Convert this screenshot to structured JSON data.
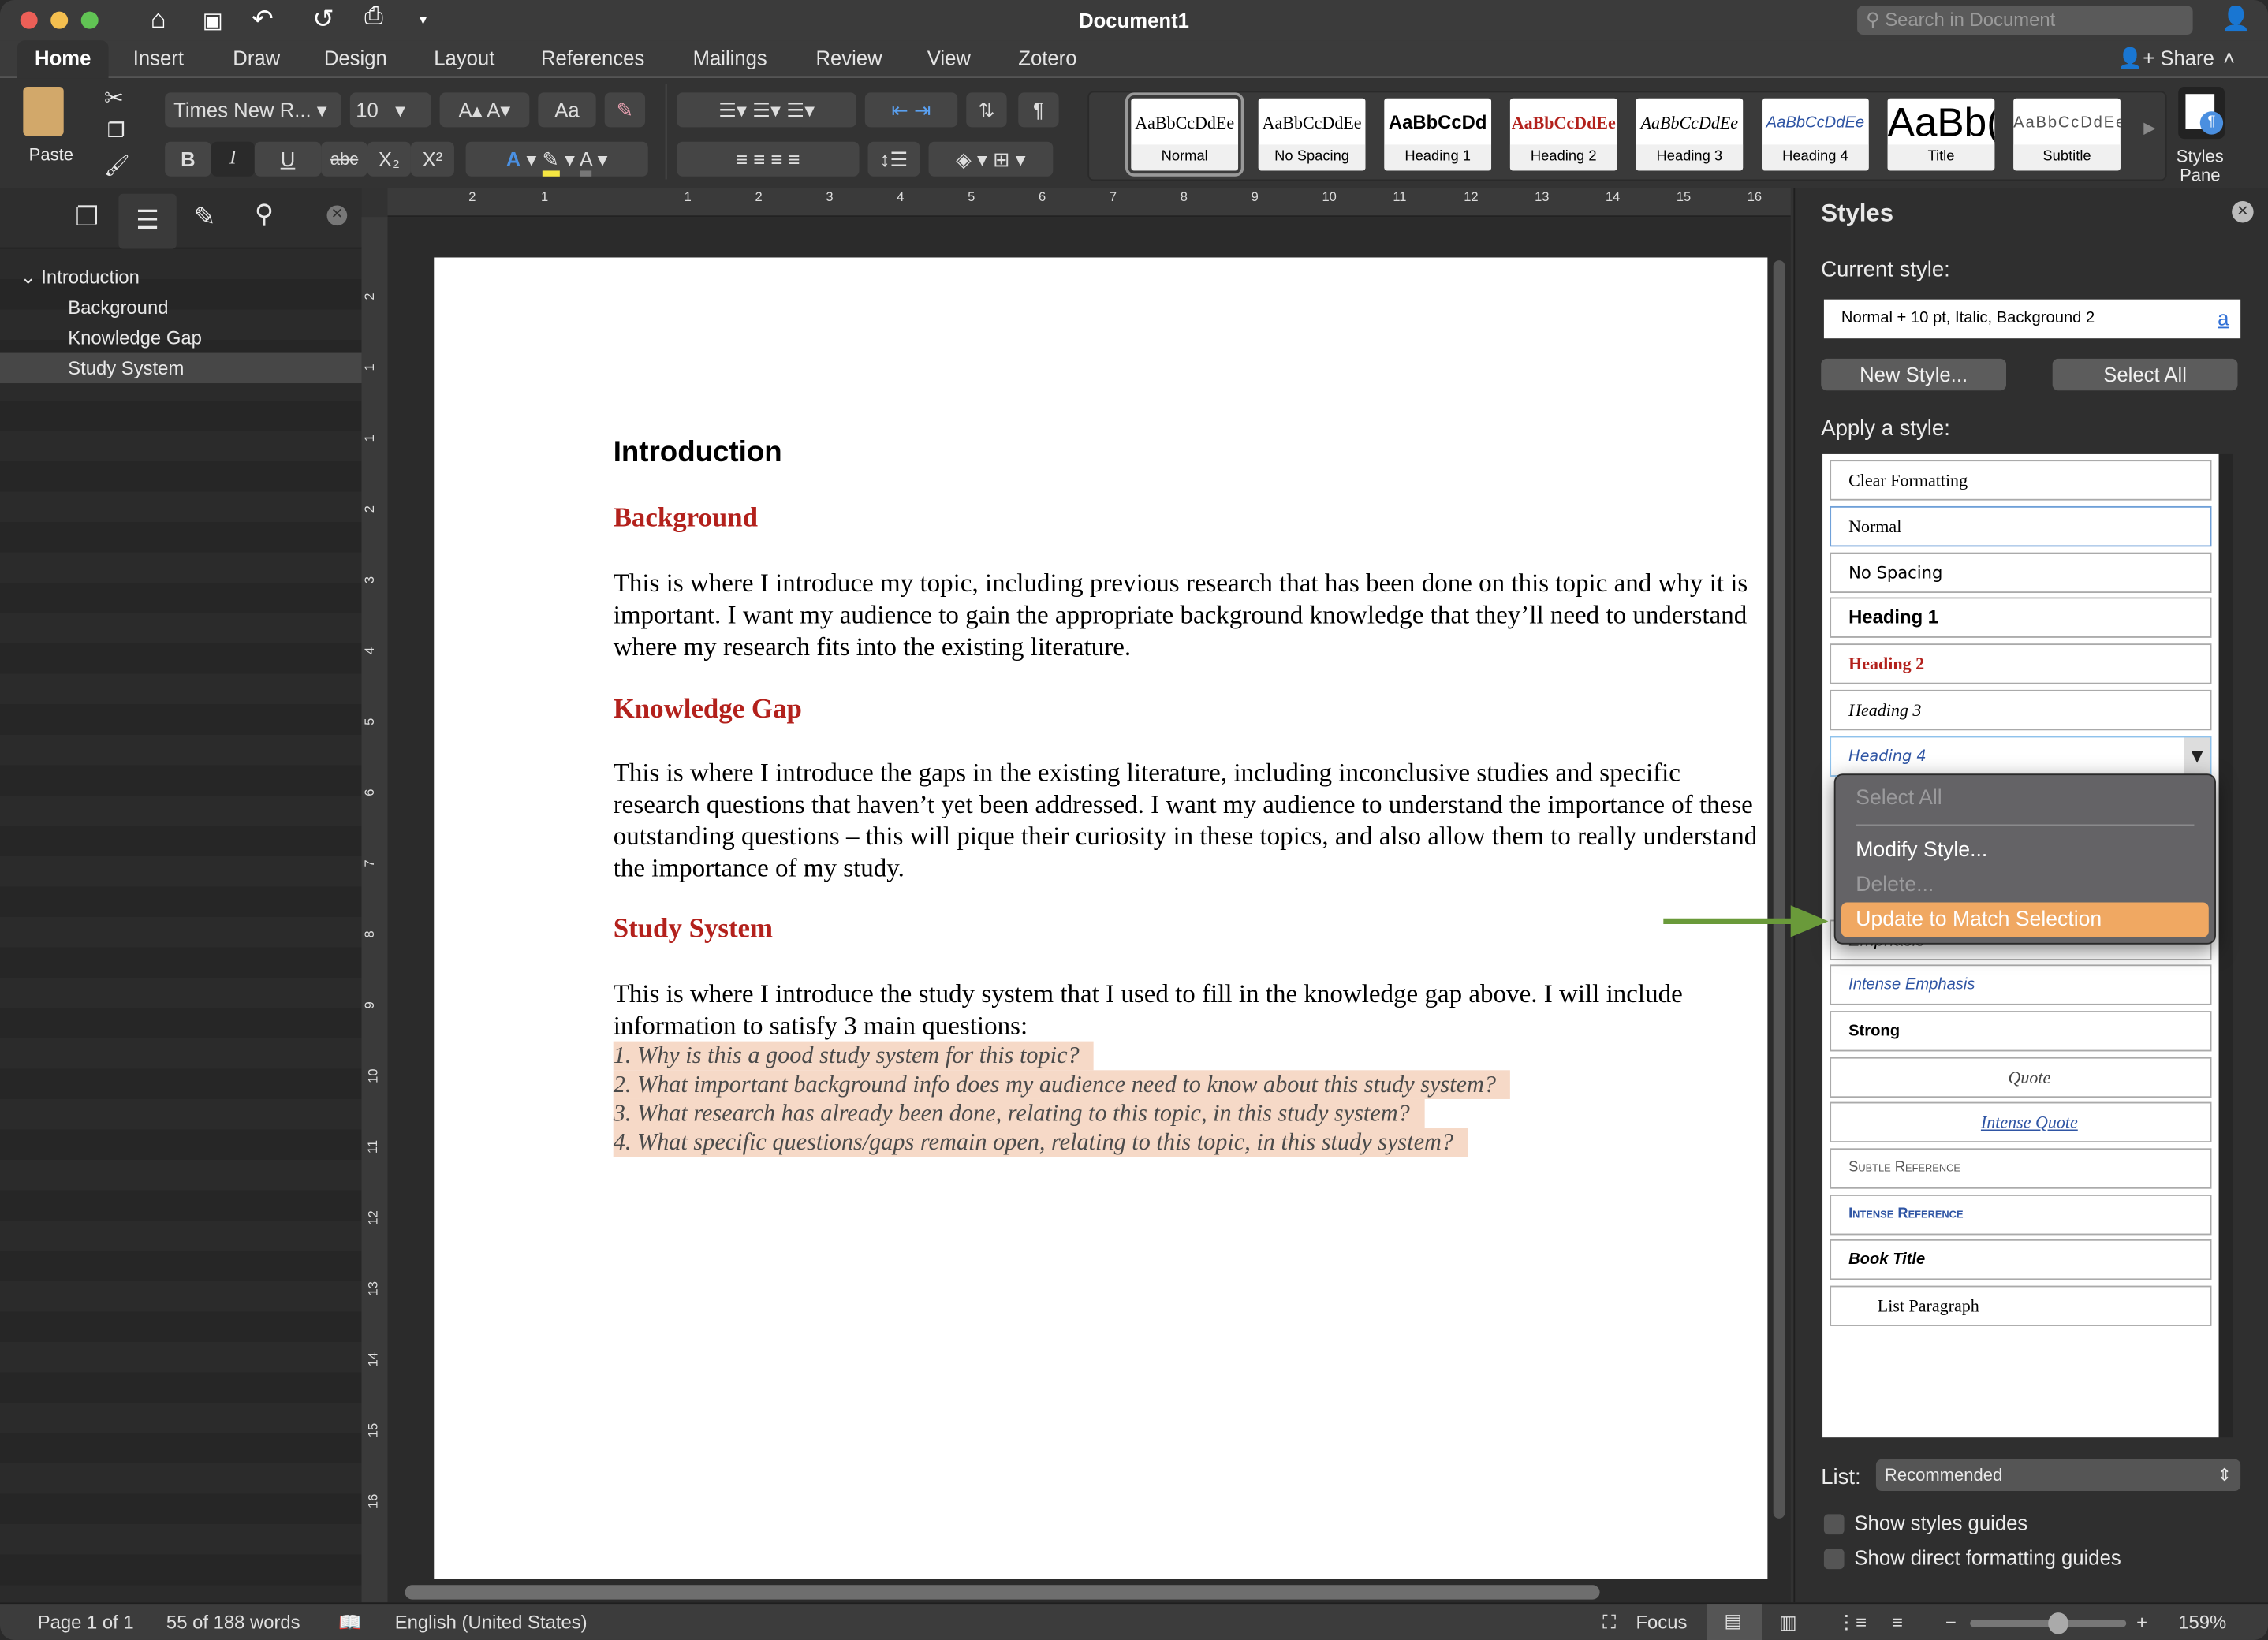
{
  "window": {
    "title": "Document1",
    "search_placeholder": "Search in Document"
  },
  "tabs": [
    "Home",
    "Insert",
    "Draw",
    "Design",
    "Layout",
    "References",
    "Mailings",
    "Review",
    "View",
    "Zotero"
  ],
  "share_label": "Share",
  "ribbon": {
    "paste_label": "Paste",
    "font_name": "Times New R...",
    "font_size": "10",
    "bold": "B",
    "italic": "I",
    "underline": "U",
    "strike": "abc",
    "sub": "X₂",
    "sup": "X²",
    "pilcrow": "¶",
    "styles_pane_label": "Styles Pane",
    "gallery": [
      {
        "sample": "AaBbCcDdEe",
        "label": "Normal",
        "color": "#000000"
      },
      {
        "sample": "AaBbCcDdEe",
        "label": "No Spacing",
        "color": "#000000"
      },
      {
        "sample": "AaBbCcDd",
        "label": "Heading 1",
        "color": "#000000"
      },
      {
        "sample": "AaBbCcDdEe",
        "label": "Heading 2",
        "color": "#b3211c"
      },
      {
        "sample": "AaBbCcDdEe",
        "label": "Heading 3",
        "color": "#000000"
      },
      {
        "sample": "AaBbCcDdEe",
        "label": "Heading 4",
        "color": "#2f55a4"
      },
      {
        "sample": "AaBb(",
        "label": "Title",
        "color": "#000000"
      },
      {
        "sample": "AaBbCcDdEe",
        "label": "Subtitle",
        "color": "#555555"
      }
    ]
  },
  "nav": {
    "items": [
      {
        "label": "Introduction",
        "level": 1
      },
      {
        "label": "Background",
        "level": 2
      },
      {
        "label": "Knowledge Gap",
        "level": 2
      },
      {
        "label": "Study System",
        "level": 2,
        "selected": true
      }
    ]
  },
  "ruler": {
    "h_ticks": [
      "2",
      "1",
      "1",
      "2",
      "3",
      "4",
      "5",
      "6",
      "7",
      "8",
      "9",
      "10",
      "11",
      "12",
      "13",
      "14",
      "15",
      "16"
    ],
    "v_ticks": [
      "2",
      "1",
      "1",
      "2",
      "3",
      "4",
      "5",
      "6",
      "7",
      "8",
      "9",
      "10",
      "11",
      "12",
      "13",
      "14",
      "15",
      "16"
    ]
  },
  "document": {
    "h1": "Introduction",
    "sections": [
      {
        "heading": "Background",
        "text": "This is where I introduce my topic, including previous research that has been done on this topic and why it is important. I want my audience to gain the appropriate background knowledge that they’ll need to understand where my research fits into the existing literature."
      },
      {
        "heading": "Knowledge Gap",
        "text": "This is where I introduce the gaps in the existing literature, including inconclusive studies and specific research questions that haven’t yet been addressed. I want my audience to understand the importance of these outstanding questions – this will pique their curiosity in these topics, and also allow them to really understand the importance of my study."
      },
      {
        "heading": "Study System",
        "text": "This is where I introduce the study system that I used to fill in the knowledge gap above. I will include information to satisfy 3 main questions:"
      }
    ],
    "list": [
      "1. Why is this a good study system for this topic?",
      "2. What important background info does my audience need to know about this study system?",
      "3. What research has already been done, relating to this topic, in this study system?",
      "4. What specific questions/gaps remain open, relating to this topic, in this study system?"
    ],
    "highlight_color": "#f6d9c7"
  },
  "styles_pane": {
    "title": "Styles",
    "current_label": "Current style:",
    "current_value": "Normal + 10 pt, Italic, Background 2",
    "new_style": "New Style...",
    "select_all": "Select All",
    "apply_label": "Apply a style:",
    "styles": [
      "Clear Formatting",
      "Normal",
      "No Spacing",
      "Heading 1",
      "Heading 2",
      "Heading 3",
      "Heading 4",
      "Emphasis",
      "Intense Emphasis",
      "Strong",
      "Quote",
      "Intense Quote",
      "Subtle Reference",
      "Intense Reference",
      "Book Title",
      "List Paragraph"
    ],
    "list_label": "List:",
    "list_value": "Recommended",
    "show_guides": "Show styles guides",
    "show_direct": "Show direct formatting guides"
  },
  "context_menu": {
    "items": [
      {
        "label": "Select All",
        "enabled": false
      },
      {
        "label": "Modify Style...",
        "enabled": true
      },
      {
        "label": "Delete...",
        "enabled": false
      },
      {
        "label": "Update to Match Selection",
        "enabled": true,
        "highlighted": true
      }
    ],
    "highlight_color": "#f0a862"
  },
  "annotation": {
    "arrow_color": "#6a9a3a"
  },
  "status": {
    "page": "Page 1 of 1",
    "words": "55 of 188 words",
    "language": "English (United States)",
    "focus": "Focus",
    "zoom": "159%",
    "zoom_minus": "−",
    "zoom_plus": "+"
  }
}
